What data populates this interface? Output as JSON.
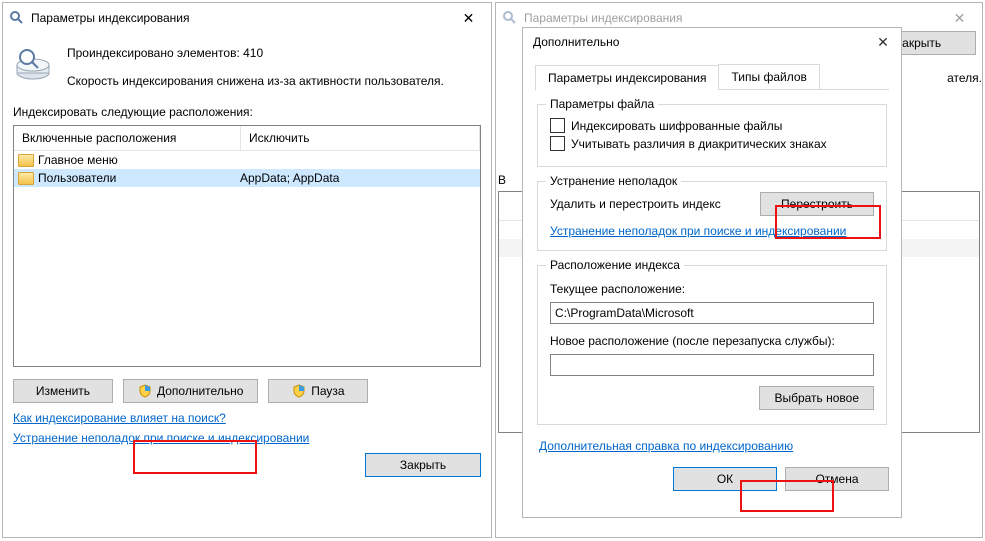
{
  "win1": {
    "title": "Параметры индексирования",
    "indexed_line": "Проиндексировано элементов: 410",
    "speed_line": "Скорость индексирования снижена из-за активности пользователя.",
    "locations_label": "Индексировать следующие расположения:",
    "col_included": "Включенные расположения",
    "col_excluded": "Исключить",
    "rows": [
      {
        "name": "Главное меню",
        "exclude": ""
      },
      {
        "name": "Пользователи",
        "exclude": "AppData; AppData"
      }
    ],
    "btn_modify": "Изменить",
    "btn_advanced": "Дополнительно",
    "btn_pause": "Пауза",
    "link_how": "Как индексирование влияет на поиск?",
    "link_tshoot": "Устранение неполадок при поиске и индексировании",
    "btn_close": "Закрыть"
  },
  "winbg": {
    "title": "Параметры индексирования",
    "speed_suffix": "ателя.",
    "locations_prefix": "В",
    "btn_close": "Закрыть"
  },
  "dlg": {
    "title": "Дополнительно",
    "tab_index": "Параметры индексирования",
    "tab_types": "Типы файлов",
    "grp_file": "Параметры файла",
    "chk_encrypted": "Индексировать шифрованные файлы",
    "chk_diacritic": "Учитывать различия в диакритических знаках",
    "grp_tshoot": "Устранение неполадок",
    "tshoot_text": "Удалить и перестроить индекс",
    "btn_rebuild": "Перестроить",
    "link_tshoot": "Устранение неполадок при поиске и индексировании",
    "grp_loc": "Расположение индекса",
    "loc_current_lbl": "Текущее расположение:",
    "loc_current_val": "C:\\ProgramData\\Microsoft",
    "loc_new_lbl": "Новое расположение (после перезапуска службы):",
    "btn_choose": "Выбрать новое",
    "link_help": "Дополнительная справка по индексированию",
    "btn_ok": "ОК",
    "btn_cancel": "Отмена"
  }
}
